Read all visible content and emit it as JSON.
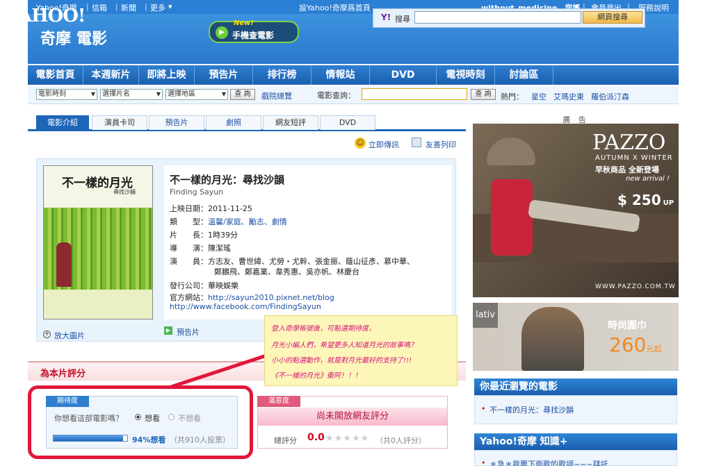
{
  "topbar": {
    "link1": "Yahoo!奇摩",
    "link2": "信箱",
    "link3": "新聞",
    "more": "更多",
    "homepage": "設Yahoo!奇摩爲首頁",
    "greeting": "without_medicine，您好",
    "logout": "會員登出",
    "help": "服務說明"
  },
  "header": {
    "logo": "YAHOO!",
    "logo_sub": "奇摩",
    "product": "電影",
    "mobile_new": "New!",
    "mobile_label": "手機查電影",
    "search_y": "Y!",
    "search_label": "搜尋",
    "search_value": "",
    "search_button": "網頁搜尋"
  },
  "nav": [
    "電影首頁",
    "本週新片",
    "即將上映",
    "預告片",
    "排行榜",
    "情報站",
    "DVD",
    "電視時刻",
    "討論區"
  ],
  "filters": {
    "select1": "電影時刻",
    "select2": "選擇片名",
    "select3": "選擇地區",
    "query_button": "查 詢",
    "browse_link": "戲院總覽",
    "movie_search_label": "電影查詢：",
    "movie_search_value": "",
    "query_button2": "查 詢",
    "hot_label": "熱門：",
    "hot1": "星空",
    "hot2": "艾瑪史東",
    "hot3": "羅伯派汀森"
  },
  "tabs": [
    "電影介紹",
    "演員卡司",
    "預告片",
    "劇照",
    "網友短評",
    "DVD"
  ],
  "actions": {
    "share": "立即傳訊",
    "print": "友善列印"
  },
  "movie": {
    "title": "不一樣的月光：尋找沙韻",
    "english_title": "Finding Sayun",
    "poster_title": "不一樣的月光",
    "poster_sub": "尋找沙韻",
    "release_label": "上映日期：",
    "release": "2011-11-25",
    "genre_label": "類　　型：",
    "genre": "溫馨/家庭、勵志、劇情",
    "length_label": "片　　長：",
    "length": "1時39分",
    "director_label": "導　　演：",
    "director": "陳潔瑤",
    "cast_label": "演　　員：",
    "cast_line1": "方志友、曹世緯、尤勞・尤幹、張金振、蔭山征彥、慕中華、",
    "cast_line2": "鄭鵬飛、鄭嘉業、韋秀惠、吳亦帆、林慶台",
    "company_label": "發行公司：",
    "company": "華映娛樂",
    "website_label": "官方網站：",
    "website": "http://sayun2010.pixnet.net/blog",
    "facebook": "http://www.facebook.com/FindingSayun",
    "enlarge": "放大圖片",
    "trailer": "預告片"
  },
  "rating": {
    "header": "為本片評分",
    "expect_tag": "期待度",
    "question": "你想看這部電影嗎？",
    "opt_yes": "想看",
    "opt_no": "不想看",
    "percent": "94%想看",
    "percent_value": 0.94,
    "votes": "（共910人投票）",
    "satis_tag": "滿意度",
    "satis_banner": "尚未開放網友評分",
    "total_label": "總評分",
    "total_score": "0.0",
    "total_votes": "（共0人評分）"
  },
  "note": {
    "line1": "登入奇摩帳號後，可點選期待度，",
    "line2": "月光小編人們，希望更多人知道月光的故事嗎？",
    "line3": "小小的點選動作，就是對月光最好的支持了!!!",
    "line4": "《不一樣的月光》衝阿！！！"
  },
  "sidebar": {
    "ad_label": "廣 告",
    "ad1_brand": "PAZZO",
    "ad1_sub": "AUTUMN X WINTER",
    "ad1_cn": "早秋商品 全新登場",
    "ad1_new": "new arrival !",
    "ad1_price": "$ 250",
    "ad1_up": "UP",
    "ad1_url": "WWW.PAZZO.COM.TW",
    "ad2_brand": "lativ",
    "ad2_text": "時尚圍巾",
    "ad2_price": "260",
    "ad2_unit": "元起",
    "recent_head": "你最近瀏覽的電影",
    "recent_item": "不一樣的月光：尋找沙韻",
    "knowledge_head": "Yahoo!奇摩 知識+",
    "knowledge_item": "＊急＊我要下面歌的歌詞~~~拜託"
  },
  "colors": {
    "brand_blue": "#1d66b8",
    "highlight_red": "#e2163b",
    "note_yellow": "#fdf6b9"
  }
}
